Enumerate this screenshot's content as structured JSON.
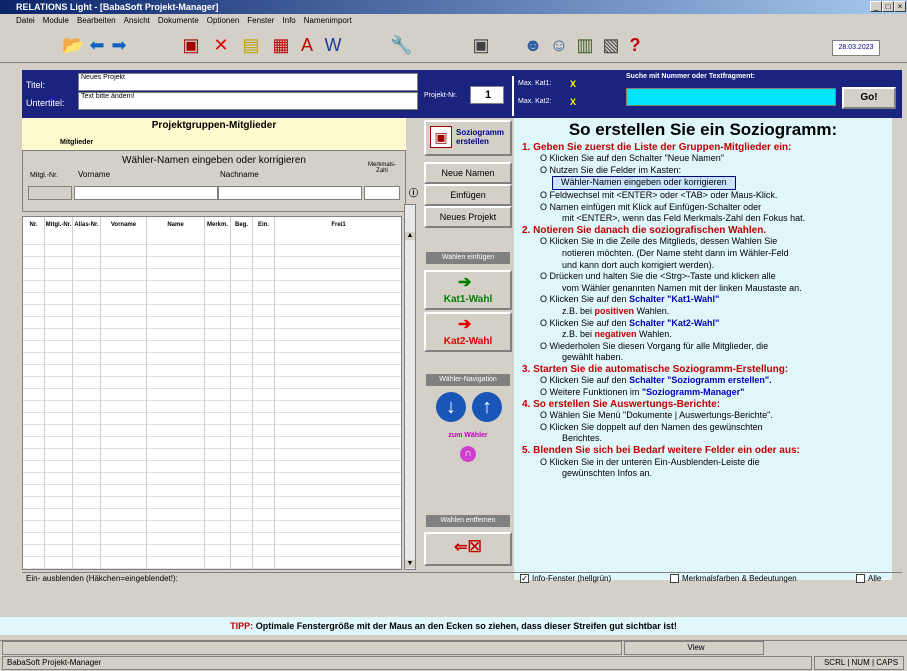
{
  "window": {
    "title": "RELATIONS Light - [BabaSoft Projekt-Manager]"
  },
  "menu": [
    "Datei",
    "Module",
    "Bearbeiten",
    "Ansicht",
    "Dokumente",
    "Optionen",
    "Fenster",
    "Info",
    "Namenimport"
  ],
  "toolbar": {
    "date": "28.03.2023",
    "help_glyph": "?"
  },
  "header": {
    "title_label": "Titel:",
    "title_value": "Neues Projekt",
    "subtitle_label": "Untertitel:",
    "subtitle_value": "Text bitte ändern!",
    "project_label": "Projekt-Nr.",
    "project_no": "1",
    "kat1_label": "Max. Kat1:",
    "kat1_value": "X",
    "kat2_label": "Max. Kat2:",
    "kat2_value": "X",
    "search_label": "Suche mit Nummer oder Textfragment:",
    "go_label": "Go!"
  },
  "members": {
    "section_title": "Projektgruppen-Mitglieder",
    "members_label": "Mitglieder",
    "entry_title": "Wähler-Namen eingeben oder korrigieren",
    "col_nr": "Mitgl.-Nr.",
    "col_first": "Vorname",
    "col_last": "Nachname",
    "col_count": "Merkmals-Zahl",
    "grid_headers": [
      "Nr.",
      "Mitgl.-Nr.",
      "Alias-Nr.",
      "Vorname",
      "Name",
      "Merkm.",
      "Beg.",
      "Ein.",
      "Frei1"
    ]
  },
  "buttons": {
    "soziogramm": "Soziogramm erstellen",
    "neue_namen": "Neue Namen",
    "einfuegen": "Einfügen",
    "neues_projekt": "Neues Projekt",
    "wahlen_einfuegen": "Wahlen einfügen",
    "kat1": "Kat1-Wahl",
    "kat2": "Kat2-Wahl",
    "waehler_navigation": "Wähler-Navigation",
    "zum_waehler": "zum Wähler",
    "wahlen_entfernen": "Wahlen entfernen"
  },
  "help": {
    "title": "So erstellen Sie ein Soziogramm:",
    "s1": "1. Geben Sie zuerst die Liste der Gruppen-Mitglieder ein:",
    "s1a": "O Klicken Sie auf den Schalter \"Neue Namen\"",
    "s1b": "O Nutzen Sie die Felder im Kasten:",
    "s1box": "Wähler-Namen eingeben oder korrigieren",
    "s1c": "O Feldwechsel mit <ENTER> oder <TAB> oder Maus-Klick.",
    "s1d": "O Namen einfügen mit Klick auf Einfügen-Schalter oder",
    "s1e": "mit <ENTER>, wenn das Feld Merkmals-Zahl den Fokus hat.",
    "s2": "2. Notieren Sie danach die soziografischen Wahlen.",
    "s2a": "O Klicken Sie in die Zeile des Mitglieds, dessen Wahlen Sie",
    "s2b": "notieren möchten. (Der Name steht dann im Wähler-Feld",
    "s2c": "und kann dort auch korrigiert werden).",
    "s2d": "O Drücken und halten Sie die <Strg>-Taste und klicken alle",
    "s2e": "vom Wähler genannten Namen mit der linken Maustaste an.",
    "s2f1": "O Klicken Sie auf den ",
    "s2f2": "Schalter \"Kat1-Wahl\"",
    "s2g1": "z.B. bei ",
    "s2g2": "positiven",
    "s2g3": " Wahlen.",
    "s2h1": "O Klicken Sie auf den ",
    "s2h2": "Schalter \"Kat2-Wahl\"",
    "s2i1": "z.B. bei ",
    "s2i2": "negativen",
    "s2i3": " Wahlen.",
    "s2j": "O Wiederholen Sie diesen Vorgang für alle Mitglieder, die",
    "s2k": "gewählt haben.",
    "s3": "3. Starten Sie die automatische Soziogramm-Erstellung:",
    "s3a1": "O Klicken Sie auf den ",
    "s3a2": "Schalter \"Soziogramm erstellen\".",
    "s3b1": "O Weitere Funktionen im ",
    "s3b2": "\"Soziogramm-Manager\"",
    "s4": "4. So erstellen Sie Auswertungs-Berichte:",
    "s4a": "O Wählen Sie Menü \"Dokumente | Auswertungs-Berichte\".",
    "s4b": "O Klicken Sie doppelt auf den Namen des gewünschten",
    "s4c": "Berichtes.",
    "s5": "5. Blenden Sie sich bei Bedarf weitere Felder ein oder aus:",
    "s5a": "O Klicken Sie in der unteren Ein-Ausblenden-Leiste die",
    "s5b": "gewünschten Infos an."
  },
  "footer": {
    "toggle_label": "Ein- ausblenden (Häkchen=eingeblendet!):",
    "info_label": "Info-Fenster (hellgrün)",
    "merkmal_label": "Merkmalsfarben & Bedeutungen",
    "alle_label": "Alle",
    "tip_prefix": "TIPP:",
    "tip": "Optimale Fenstergröße mit der Maus an den Ecken so ziehen, dass dieser Streifen gut sichtbar ist!"
  },
  "statusbar": {
    "app": "BabaSoft Projekt-Manager",
    "view": "View",
    "keys": "SCRL | NUM | CAPS"
  }
}
